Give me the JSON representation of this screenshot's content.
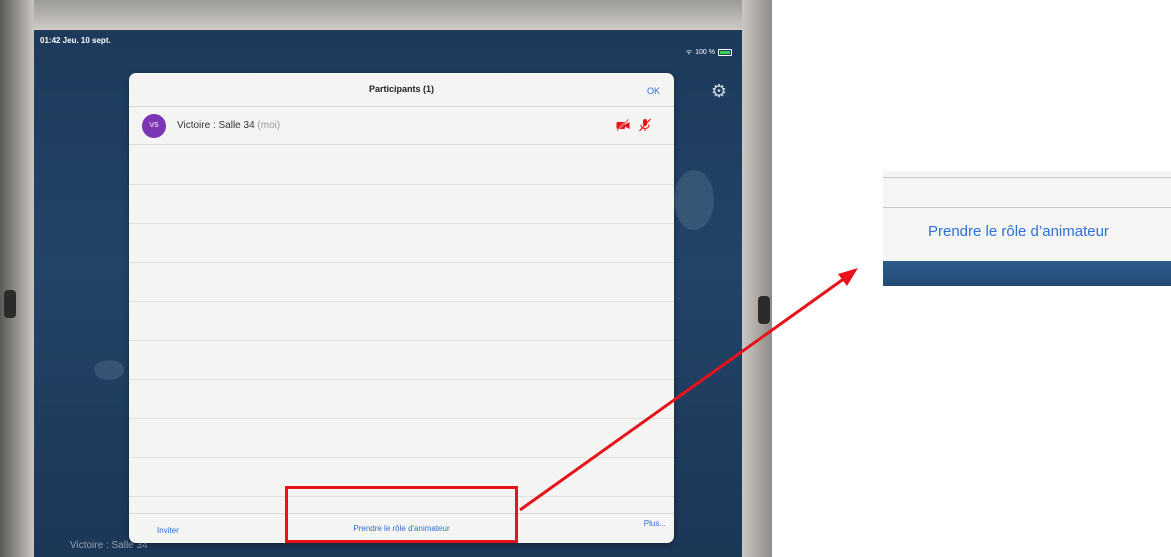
{
  "status_bar": {
    "time_date": "01:42 Jeu. 10 sept.",
    "battery": "100 %"
  },
  "background": {
    "room_name": "Victoire : Salle 34"
  },
  "participants_dialog": {
    "title": "Participants (1)",
    "ok_label": "OK",
    "participants": [
      {
        "initials": "VS",
        "name": "Victoire : Salle 34",
        "suffix": "(moi)",
        "video_muted": true,
        "audio_muted": true
      }
    ],
    "footer": {
      "invite_label": "Inviter",
      "take_host_label": "Prendre le rôle d'animateur",
      "more_label": "Plus..."
    }
  },
  "zoom_callout": {
    "label": "Prendre le rôle d’animateur"
  },
  "colors": {
    "accent_blue": "#2f6fd6",
    "avatar_purple": "#7b35b5",
    "annotation_red": "#e8121b",
    "mute_red": "#e8121b"
  },
  "icons": {
    "settings": "gear-icon",
    "video": "video-off-icon",
    "mic": "mic-off-icon"
  }
}
